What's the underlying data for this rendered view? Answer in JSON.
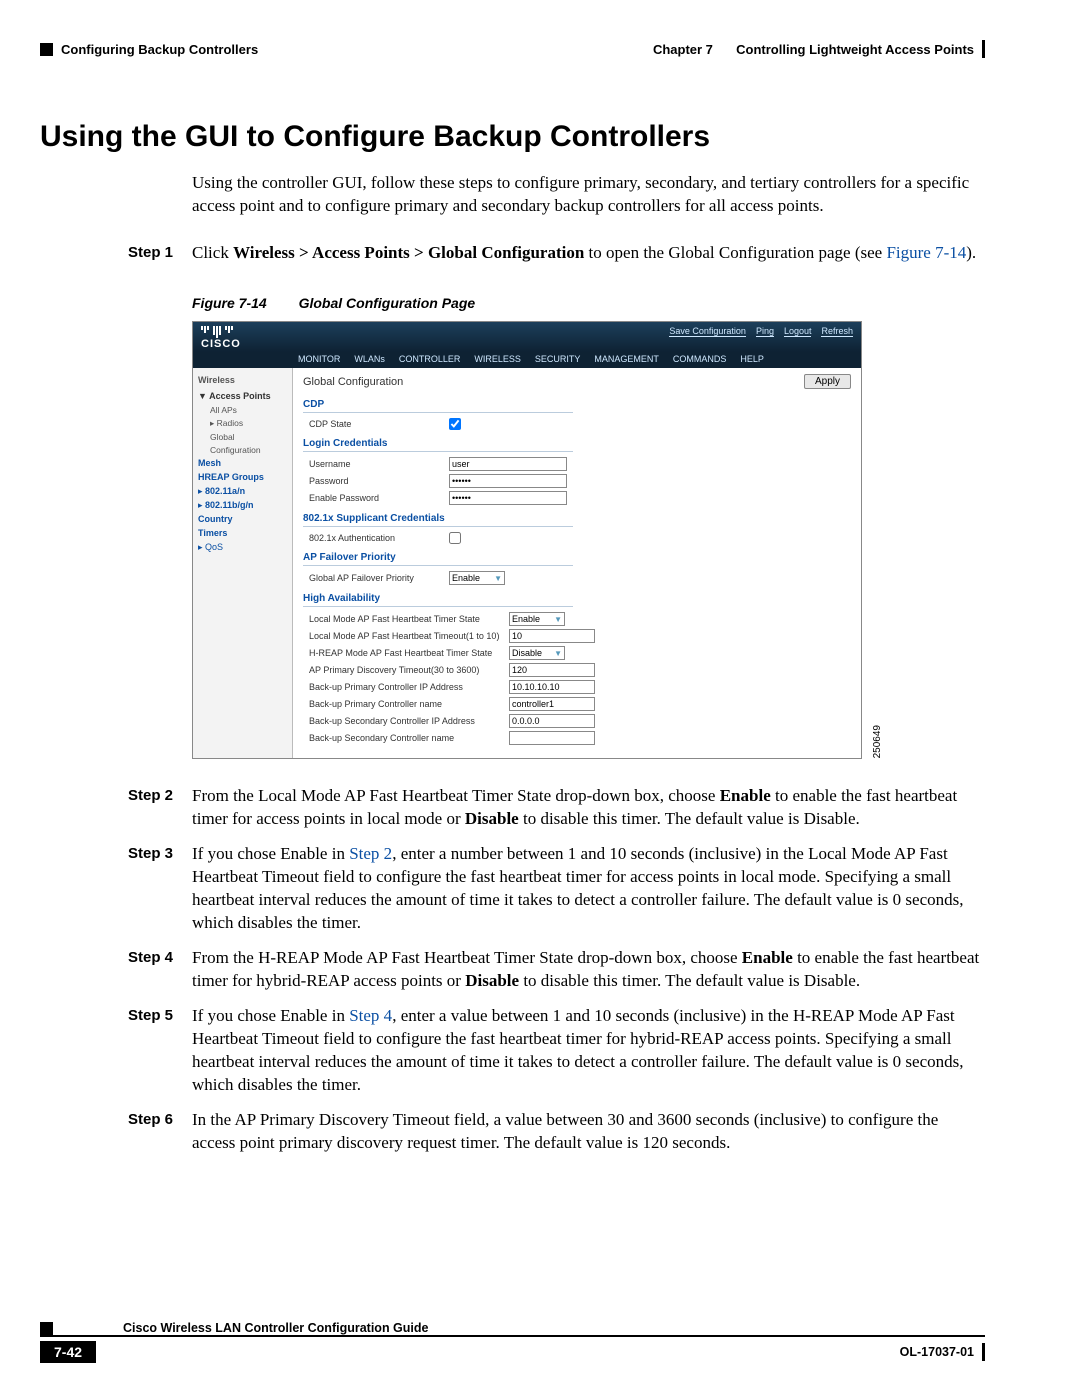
{
  "header": {
    "chapter": "Chapter 7",
    "chapter_title": "Controlling Lightweight Access Points",
    "breadcrumb": "Configuring Backup Controllers"
  },
  "section_title": "Using the GUI to Configure Backup Controllers",
  "intro": "Using the controller GUI, follow these steps to configure primary, secondary, and tertiary controllers for a specific access point and to configure primary and secondary backup controllers for all access points.",
  "steps": {
    "s1": {
      "label": "Step 1",
      "prefix": "Click ",
      "bold": "Wireless > Access Points > Global Configuration",
      "mid": " to open the Global Configuration page (see ",
      "link": "Figure 7-14",
      "suffix": ")."
    },
    "s2": {
      "label": "Step 2",
      "a": "From the Local Mode AP Fast Heartbeat Timer State drop-down box, choose ",
      "b1": "Enable",
      "b": " to enable the fast heartbeat timer for access points in local mode or ",
      "b2": "Disable",
      "c": " to disable this timer. The default value is Disable."
    },
    "s3": {
      "label": "Step 3",
      "a": "If you chose Enable in ",
      "link": "Step 2",
      "b": ", enter a number between 1 and 10 seconds (inclusive) in the Local Mode AP Fast Heartbeat Timeout field to configure the fast heartbeat timer for access points in local mode. Specifying a small heartbeat interval reduces the amount of time it takes to detect a controller failure. The default value is 0 seconds, which disables the timer."
    },
    "s4": {
      "label": "Step 4",
      "a": "From the H-REAP Mode AP Fast Heartbeat Timer State drop-down box, choose ",
      "b1": "Enable",
      "b": " to enable the fast heartbeat timer for hybrid-REAP access points or ",
      "b2": "Disable",
      "c": " to disable this timer. The default value is Disable."
    },
    "s5": {
      "label": "Step 5",
      "a": "If you chose Enable in ",
      "link": "Step 4",
      "b": ", enter a value between 1 and 10 seconds (inclusive) in the H-REAP Mode AP Fast Heartbeat Timeout field to configure the fast heartbeat timer for hybrid-REAP access points. Specifying a small heartbeat interval reduces the amount of time it takes to detect a controller failure. The default value is 0 seconds, which disables the timer."
    },
    "s6": {
      "label": "Step 6",
      "text": "In the AP Primary Discovery Timeout field, a value between 30 and 3600 seconds (inclusive) to configure the access point primary discovery request timer. The default value is 120 seconds."
    }
  },
  "figure": {
    "num": "Figure 7-14",
    "title": "Global Configuration Page",
    "sidenum": "250649"
  },
  "screenshot": {
    "brand": "CISCO",
    "toplinks": [
      "Save Configuration",
      "Ping",
      "Logout",
      "Refresh"
    ],
    "nav": [
      "MONITOR",
      "WLANs",
      "CONTROLLER",
      "WIRELESS",
      "SECURITY",
      "MANAGEMENT",
      "COMMANDS",
      "HELP"
    ],
    "left_title": "Wireless",
    "left": {
      "access_points": "Access Points",
      "all_aps": "All APs",
      "radios": "Radios",
      "global_conf": "Global Configuration",
      "mesh": "Mesh",
      "hreap": "HREAP Groups",
      "b80211an": "802.11a/n",
      "b80211bgn": "802.11b/g/n",
      "country": "Country",
      "timers": "Timers",
      "qos": "QoS"
    },
    "main_title": "Global Configuration",
    "apply": "Apply",
    "sect_cdp": "CDP",
    "row_cdp_state": "CDP State",
    "sect_login": "Login Credentials",
    "row_user": "Username",
    "val_user": "user",
    "row_pass": "Password",
    "row_enpass": "Enable Password",
    "val_pass": "••••••",
    "sect_supp": "802.1x Supplicant Credentials",
    "row_auth": "802.1x Authentication",
    "sect_failover": "AP Failover Priority",
    "row_failover": "Global AP Failover Priority",
    "val_enable": "Enable",
    "val_disable": "Disable",
    "sect_ha": "High Availability",
    "ha": {
      "r1": "Local Mode AP Fast Heartbeat Timer State",
      "r2": "Local Mode AP Fast Heartbeat Timeout(1 to 10)",
      "r2v": "10",
      "r3": "H-REAP Mode AP Fast Heartbeat Timer State",
      "r4": "AP Primary Discovery Timeout(30 to 3600)",
      "r4v": "120",
      "r5": "Back-up Primary Controller IP Address",
      "r5v": "10.10.10.10",
      "r6": "Back-up Primary Controller name",
      "r6v": "controller1",
      "r7": "Back-up Secondary Controller IP Address",
      "r7v": "0.0.0.0",
      "r8": "Back-up Secondary Controller name"
    }
  },
  "footer": {
    "guide": "Cisco Wireless LAN Controller Configuration Guide",
    "page": "7-42",
    "doc_id": "OL-17037-01"
  }
}
